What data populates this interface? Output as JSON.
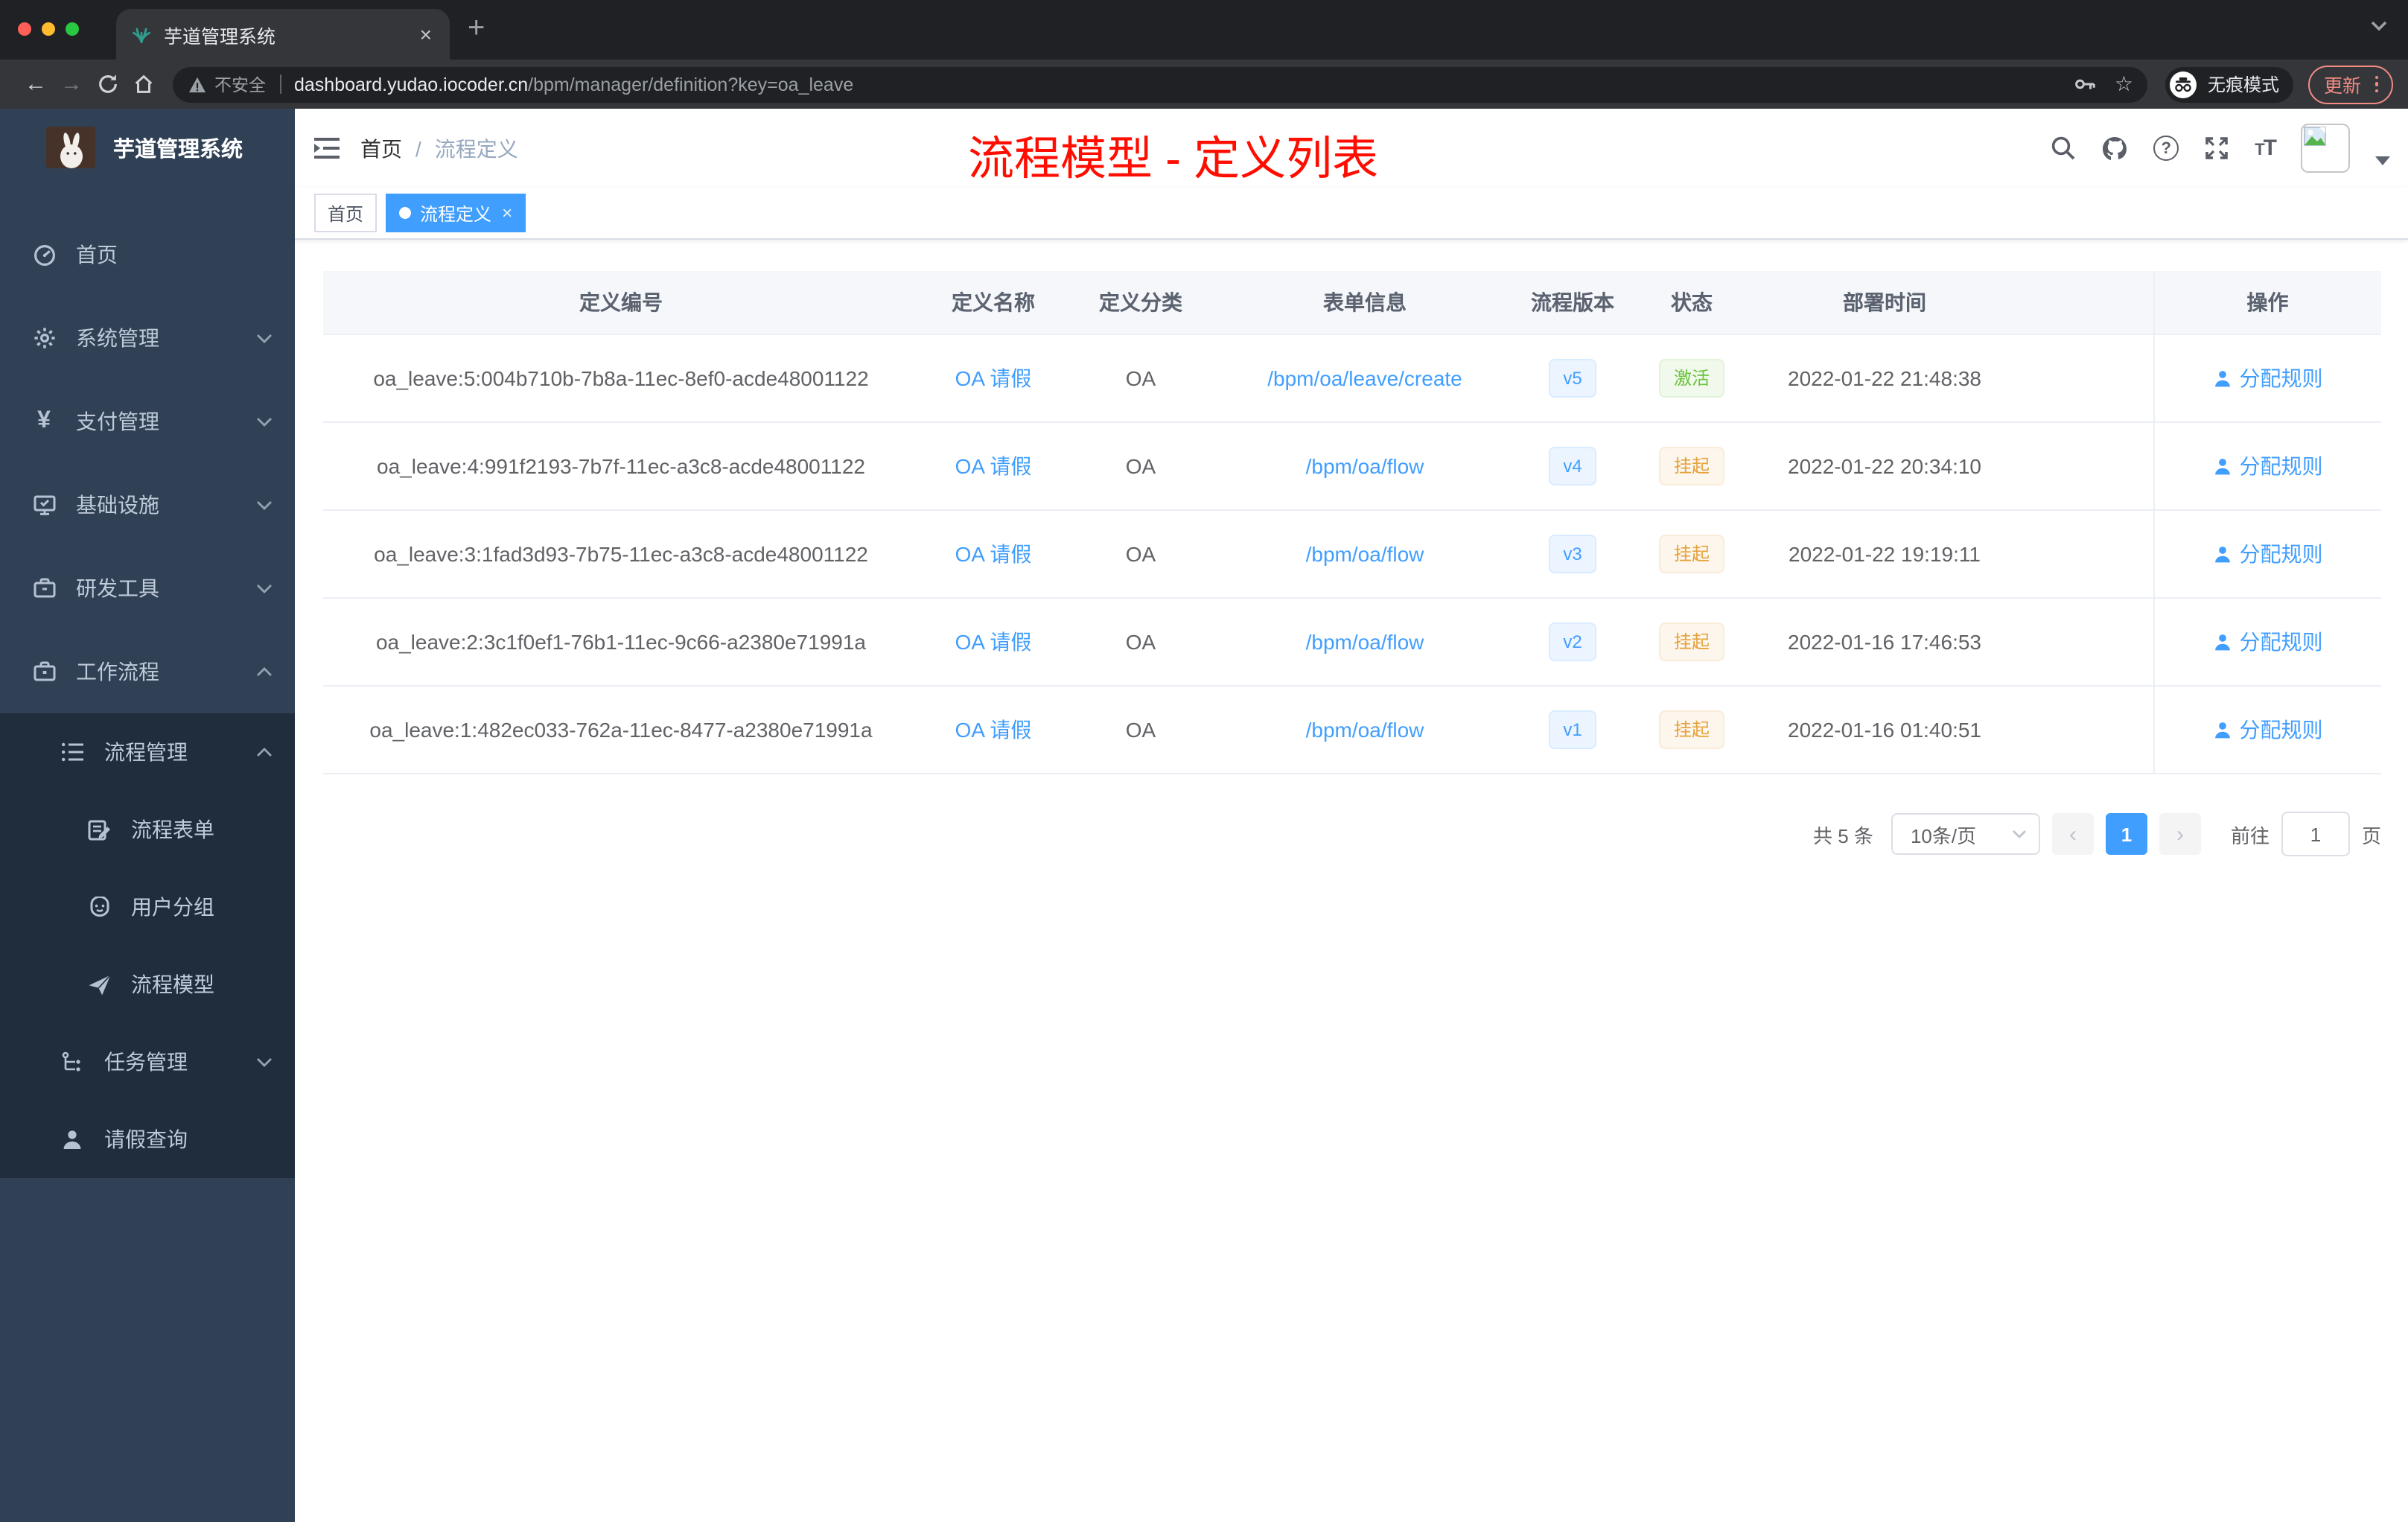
{
  "colors": {
    "primary": "#409EFF",
    "success": "#67C23A",
    "warning": "#E6A23C",
    "annotation_red": "#FF0D00",
    "update_salmon": "#F28B82",
    "sidebar_bg": "#304156",
    "submenu_bg": "#1F2D3D",
    "tab_active_bg": "#409EFF"
  },
  "browser": {
    "tab_title": "芋道管理系统",
    "tab_close": "×",
    "new_tab": "+",
    "security_label": "不安全",
    "url_host": "dashboard.yudao.iocoder.cn",
    "url_path": "/bpm/manager/definition?key=oa_leave",
    "back": "←",
    "forward": "→",
    "incognito_label": "无痕模式",
    "update_label": "更新"
  },
  "sidebar": {
    "brand": "芋道管理系统",
    "items": [
      {
        "label": "首页",
        "icon": "dashboard-icon"
      },
      {
        "label": "系统管理",
        "icon": "gear-icon"
      },
      {
        "label": "支付管理",
        "icon": "yen-icon"
      },
      {
        "label": "基础设施",
        "icon": "monitor-icon"
      },
      {
        "label": "研发工具",
        "icon": "toolbox-icon"
      },
      {
        "label": "工作流程",
        "icon": "briefcase-icon"
      }
    ],
    "sub": {
      "process_mgmt": "流程管理",
      "process_form": "流程表单",
      "user_group": "用户分组",
      "process_model": "流程模型",
      "task_mgmt": "任务管理",
      "leave_query": "请假查询"
    }
  },
  "header": {
    "breadcrumb_home": "首页",
    "breadcrumb_sep": "/",
    "breadcrumb_current": "流程定义",
    "annotation": "流程模型 - 定义列表",
    "icons": [
      "search-icon",
      "github-icon",
      "help-icon",
      "fullscreen-icon",
      "font-size-icon",
      "avatar",
      "caret-down-icon"
    ]
  },
  "tags": {
    "home": "首页",
    "active": "流程定义",
    "close": "×"
  },
  "table": {
    "columns": [
      {
        "label": "定义编号"
      },
      {
        "label": "定义名称"
      },
      {
        "label": "定义分类"
      },
      {
        "label": "表单信息"
      },
      {
        "label": "流程版本"
      },
      {
        "label": "状态"
      },
      {
        "label": "部署时间"
      },
      {
        "label": "操作"
      }
    ],
    "rows": [
      {
        "id": "oa_leave:5:004b710b-7b8a-11ec-8ef0-acde48001122",
        "name": "OA 请假",
        "category": "OA",
        "form": "/bpm/oa/leave/create",
        "version": "v5",
        "status": "激活",
        "time": "2022-01-22 21:48:38",
        "action": "分配规则"
      },
      {
        "id": "oa_leave:4:991f2193-7b7f-11ec-a3c8-acde48001122",
        "name": "OA 请假",
        "category": "OA",
        "form": "/bpm/oa/flow",
        "version": "v4",
        "status": "挂起",
        "time": "2022-01-22 20:34:10",
        "action": "分配规则"
      },
      {
        "id": "oa_leave:3:1fad3d93-7b75-11ec-a3c8-acde48001122",
        "name": "OA 请假",
        "category": "OA",
        "form": "/bpm/oa/flow",
        "version": "v3",
        "status": "挂起",
        "time": "2022-01-22 19:19:11",
        "action": "分配规则"
      },
      {
        "id": "oa_leave:2:3c1f0ef1-76b1-11ec-9c66-a2380e71991a",
        "name": "OA 请假",
        "category": "OA",
        "form": "/bpm/oa/flow",
        "version": "v2",
        "status": "挂起",
        "time": "2022-01-16 17:46:53",
        "action": "分配规则"
      },
      {
        "id": "oa_leave:1:482ec033-762a-11ec-8477-a2380e71991a",
        "name": "OA 请假",
        "category": "OA",
        "form": "/bpm/oa/flow",
        "version": "v1",
        "status": "挂起",
        "time": "2022-01-16 01:40:51",
        "action": "分配规则"
      }
    ]
  },
  "pagination": {
    "total": "共 5 条",
    "page_size": "10条/页",
    "prev": "‹",
    "current": "1",
    "next": "›",
    "goto_label": "前往",
    "goto_value": "1",
    "unit": "页"
  }
}
